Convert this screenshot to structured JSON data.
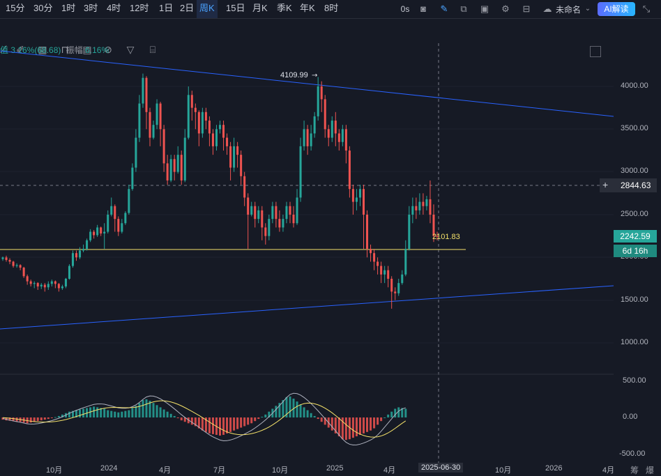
{
  "timeframes": [
    "15分",
    "30分",
    "1时",
    "3时",
    "4时",
    "12时",
    "1日",
    "2日",
    "周K",
    "15日",
    "月K",
    "季K",
    "年K",
    "8时"
  ],
  "active_timeframe": "周K",
  "top_right": {
    "timer": "0s",
    "layout_name": "未命名",
    "ai_button": "AI解读"
  },
  "ohlc_info": {
    "change": "值 3.16%(68.68)",
    "amplitude_label": "振幅",
    "amplitude": "6.16%"
  },
  "price_axis": [
    "4000.00",
    "3500.00",
    "3000.00",
    "2500.00",
    "2000.00",
    "1500.00",
    "1000.00"
  ],
  "macd_axis": [
    "500.00",
    "0.00",
    "-500.00"
  ],
  "markers": {
    "high_label": "4109.99",
    "line_label": "2101.83",
    "crosshair_price": "2844.63",
    "last_price": "2242.59",
    "countdown": "6d 16h"
  },
  "time_axis": [
    {
      "label": "10月"
    },
    {
      "label": "2024"
    },
    {
      "label": "4月"
    },
    {
      "label": "7月"
    },
    {
      "label": "10月"
    },
    {
      "label": "2025"
    },
    {
      "label": "4月"
    },
    {
      "label": "2025-06-30"
    },
    {
      "label": "10月"
    },
    {
      "label": "2026"
    },
    {
      "label": "4月"
    }
  ],
  "bottom_icons": [
    "筹",
    "爆"
  ],
  "colors": {
    "up": "#26a69a",
    "down": "#ef5350",
    "bg": "#161a25",
    "accent": "#2962ff",
    "hline": "#f5e26a",
    "last": "#26a69a"
  },
  "chart_data": {
    "type": "candlestick",
    "ylim": [
      900,
      4400
    ],
    "candles": [
      [
        1980,
        2000,
        1960,
        2010
      ],
      [
        2000,
        1970,
        1950,
        2020
      ],
      [
        1970,
        1950,
        1920,
        1990
      ],
      [
        1950,
        1900,
        1880,
        1960
      ],
      [
        1900,
        1910,
        1880,
        1930
      ],
      [
        1910,
        1880,
        1850,
        1920
      ],
      [
        1880,
        1780,
        1760,
        1890
      ],
      [
        1780,
        1720,
        1680,
        1800
      ],
      [
        1720,
        1690,
        1660,
        1740
      ],
      [
        1690,
        1700,
        1640,
        1720
      ],
      [
        1700,
        1660,
        1620,
        1710
      ],
      [
        1660,
        1680,
        1630,
        1700
      ],
      [
        1680,
        1650,
        1600,
        1700
      ],
      [
        1650,
        1690,
        1620,
        1720
      ],
      [
        1690,
        1720,
        1660,
        1740
      ],
      [
        1720,
        1690,
        1640,
        1730
      ],
      [
        1690,
        1640,
        1600,
        1700
      ],
      [
        1640,
        1660,
        1620,
        1680
      ],
      [
        1660,
        1750,
        1640,
        1760
      ],
      [
        1750,
        1900,
        1740,
        1920
      ],
      [
        1900,
        2050,
        1880,
        2080
      ],
      [
        2050,
        2000,
        1960,
        2080
      ],
      [
        2000,
        2080,
        1980,
        2120
      ],
      [
        2080,
        2100,
        2060,
        2150
      ],
      [
        2100,
        2200,
        2080,
        2220
      ],
      [
        2200,
        2300,
        2180,
        2330
      ],
      [
        2300,
        2260,
        2220,
        2320
      ],
      [
        2260,
        2350,
        2240,
        2380
      ],
      [
        2350,
        2280,
        2250,
        2360
      ],
      [
        2280,
        2300,
        2100,
        2400
      ],
      [
        2300,
        2500,
        2280,
        2550
      ],
      [
        2500,
        2600,
        2480,
        2700
      ],
      [
        2600,
        2450,
        2300,
        2620
      ],
      [
        2450,
        2300,
        2250,
        2480
      ],
      [
        2300,
        2400,
        2280,
        2450
      ],
      [
        2400,
        2520,
        2380,
        2540
      ],
      [
        2520,
        2800,
        2500,
        2850
      ],
      [
        2800,
        3050,
        2780,
        3100
      ],
      [
        3050,
        3400,
        3000,
        3500
      ],
      [
        3400,
        3800,
        3350,
        3900
      ],
      [
        3800,
        4100,
        3750,
        4150
      ],
      [
        4100,
        3700,
        3500,
        4120
      ],
      [
        3700,
        3400,
        3300,
        3750
      ],
      [
        3400,
        3550,
        3380,
        3600
      ],
      [
        3550,
        3800,
        3500,
        3850
      ],
      [
        3800,
        3500,
        3300,
        3820
      ],
      [
        3500,
        3100,
        3000,
        3550
      ],
      [
        3100,
        2900,
        2850,
        3200
      ],
      [
        2900,
        3150,
        2880,
        3200
      ],
      [
        3150,
        3000,
        2900,
        3200
      ],
      [
        3000,
        3200,
        2980,
        3300
      ],
      [
        3200,
        2900,
        2850,
        3250
      ],
      [
        2900,
        3400,
        2880,
        3500
      ],
      [
        3400,
        3900,
        3380,
        4000
      ],
      [
        3900,
        3750,
        3600,
        3950
      ],
      [
        3750,
        3700,
        3500,
        3800
      ],
      [
        3700,
        3450,
        3300,
        3720
      ],
      [
        3450,
        3700,
        3400,
        3750
      ],
      [
        3700,
        3600,
        3500,
        3750
      ],
      [
        3600,
        3450,
        3300,
        3650
      ],
      [
        3450,
        3300,
        3200,
        3500
      ],
      [
        3300,
        3500,
        3250,
        3550
      ],
      [
        3500,
        3550,
        3450,
        3600
      ],
      [
        3550,
        3400,
        3250,
        3600
      ],
      [
        3400,
        3300,
        3200,
        3450
      ],
      [
        3300,
        3050,
        2900,
        3350
      ],
      [
        3050,
        3300,
        3000,
        3400
      ],
      [
        3300,
        3200,
        3050,
        3350
      ],
      [
        3200,
        2950,
        2850,
        3250
      ],
      [
        2950,
        2700,
        2600,
        3000
      ],
      [
        2700,
        2500,
        2100,
        2750
      ],
      [
        2500,
        2600,
        2480,
        2650
      ],
      [
        2600,
        2450,
        2350,
        2650
      ],
      [
        2450,
        2550,
        2400,
        2600
      ],
      [
        2550,
        2350,
        2200,
        2600
      ],
      [
        2350,
        2250,
        2150,
        2400
      ],
      [
        2250,
        2450,
        2200,
        2500
      ],
      [
        2450,
        2600,
        2400,
        2650
      ],
      [
        2600,
        2450,
        2350,
        2650
      ],
      [
        2450,
        2350,
        2300,
        2550
      ],
      [
        2350,
        2450,
        2300,
        2500
      ],
      [
        2450,
        2600,
        2400,
        2650
      ],
      [
        2600,
        2500,
        2400,
        2650
      ],
      [
        2500,
        2400,
        2350,
        2600
      ],
      [
        2400,
        2700,
        2380,
        2800
      ],
      [
        2700,
        3300,
        2650,
        3400
      ],
      [
        3300,
        3500,
        3250,
        3600
      ],
      [
        3500,
        3300,
        3200,
        3550
      ],
      [
        3300,
        3450,
        3250,
        3550
      ],
      [
        3450,
        3650,
        3400,
        3700
      ],
      [
        3650,
        4000,
        3600,
        4110
      ],
      [
        4000,
        3850,
        3700,
        4060
      ],
      [
        3850,
        3500,
        3400,
        3900
      ],
      [
        3500,
        3400,
        3300,
        3550
      ],
      [
        3400,
        3600,
        3350,
        3650
      ],
      [
        3600,
        3450,
        3300,
        3700
      ],
      [
        3450,
        3350,
        3250,
        3500
      ],
      [
        3350,
        3500,
        3300,
        3550
      ],
      [
        3500,
        3250,
        3100,
        3550
      ],
      [
        3250,
        2800,
        2700,
        3300
      ],
      [
        2800,
        2650,
        2500,
        2850
      ],
      [
        2650,
        2700,
        2550,
        2800
      ],
      [
        2700,
        2800,
        2600,
        2850
      ],
      [
        2800,
        2500,
        2100,
        2850
      ],
      [
        2500,
        2100,
        2000,
        2550
      ],
      [
        2100,
        2050,
        1950,
        2150
      ],
      [
        2050,
        1950,
        1850,
        2100
      ],
      [
        1950,
        1900,
        1800,
        2000
      ],
      [
        1900,
        1800,
        1700,
        1950
      ],
      [
        1800,
        1850,
        1700,
        1900
      ],
      [
        1850,
        1750,
        1650,
        1900
      ],
      [
        1750,
        1600,
        1400,
        1780
      ],
      [
        1600,
        1580,
        1500,
        1650
      ],
      [
        1580,
        1700,
        1550,
        1750
      ],
      [
        1700,
        1800,
        1680,
        1850
      ],
      [
        1800,
        2100,
        1780,
        2200
      ],
      [
        2100,
        2500,
        2080,
        2600
      ],
      [
        2500,
        2600,
        2400,
        2700
      ],
      [
        2600,
        2550,
        2450,
        2700
      ],
      [
        2550,
        2650,
        2500,
        2750
      ],
      [
        2650,
        2600,
        2500,
        2750
      ],
      [
        2600,
        2680,
        2550,
        2720
      ],
      [
        2680,
        2500,
        2400,
        2900
      ],
      [
        2500,
        2250,
        2180,
        2620
      ],
      [
        2250,
        2240,
        2200,
        2300
      ]
    ],
    "macd_hist": [
      -30,
      -40,
      -45,
      -50,
      -55,
      -60,
      -70,
      -80,
      -70,
      -60,
      -50,
      -40,
      -30,
      -20,
      -10,
      5,
      20,
      40,
      60,
      80,
      90,
      100,
      110,
      120,
      130,
      140,
      150,
      140,
      130,
      120,
      100,
      90,
      80,
      70,
      80,
      90,
      100,
      130,
      160,
      200,
      240,
      250,
      230,
      200,
      170,
      140,
      110,
      80,
      50,
      20,
      -10,
      -40,
      -60,
      -80,
      -100,
      -120,
      -150,
      -180,
      -200,
      -220,
      -230,
      -240,
      -250,
      -240,
      -220,
      -200,
      -180,
      -160,
      -140,
      -120,
      -100,
      -80,
      -50,
      -20,
      10,
      40,
      80,
      120,
      160,
      200,
      240,
      280,
      290,
      260,
      220,
      180,
      140,
      100,
      60,
      20,
      -20,
      -60,
      -100,
      -140,
      -180,
      -220,
      -260,
      -300,
      -310,
      -300,
      -280,
      -260,
      -240,
      -220,
      -200,
      -180,
      -150,
      -100,
      -50,
      0,
      40,
      80,
      120,
      140,
      130,
      120
    ]
  }
}
